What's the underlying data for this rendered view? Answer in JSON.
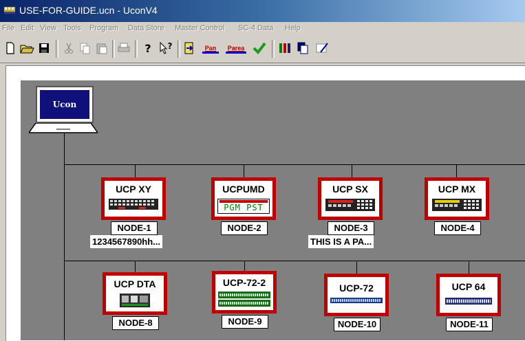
{
  "window": {
    "title": "USE-FOR-GUIDE.ucn - UconV4"
  },
  "menu": [
    "File",
    "Edit",
    "View",
    "Tools",
    "Program",
    "Data Store",
    "Master Control",
    "SC-4 Data",
    "Help"
  ],
  "toolbar": {
    "pan_label": "Pan",
    "parea_label": "Parea"
  },
  "host": {
    "label": "Ucon"
  },
  "nodes": [
    {
      "title": "UCP XY",
      "name": "NODE-1",
      "desc": "1234567890hh...",
      "device": "xy"
    },
    {
      "title": "UCPUMD",
      "name": "NODE-2",
      "desc": "",
      "device": "umd",
      "umd_text": "PGM PST"
    },
    {
      "title": "UCP  SX",
      "name": "NODE-3",
      "desc": "THIS IS A PA...",
      "device": "sx"
    },
    {
      "title": "UCP MX",
      "name": "NODE-4",
      "desc": "",
      "device": "mx"
    },
    {
      "title": "UCP  DTA",
      "name": "NODE-8",
      "desc": "",
      "device": "dta"
    },
    {
      "title": "UCP-72-2",
      "name": "NODE-9",
      "desc": "",
      "device": "72-2"
    },
    {
      "title": "UCP-72",
      "name": "NODE-10",
      "desc": "",
      "device": "72"
    },
    {
      "title": "UCP 64",
      "name": "NODE-11",
      "desc": "",
      "device": "64"
    }
  ],
  "colors": {
    "node_border": "#c00000",
    "canvas": "#808080",
    "title_start": "#0a246a",
    "host_screen": "#10107a"
  }
}
